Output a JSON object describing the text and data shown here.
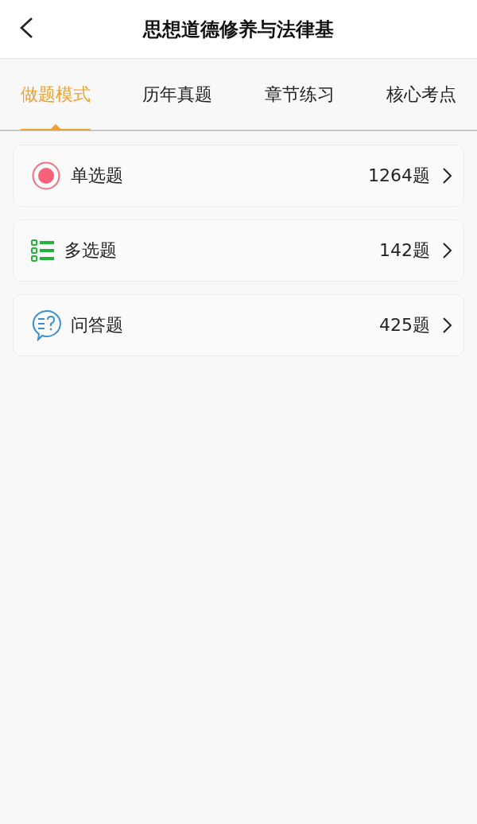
{
  "header": {
    "title": "思想道德修养与法律基"
  },
  "tabs": [
    {
      "label": "做题模式",
      "selected": true
    },
    {
      "label": "历年真题",
      "selected": false
    },
    {
      "label": "章节练习",
      "selected": false
    },
    {
      "label": "核心考点",
      "selected": false
    }
  ],
  "question_types": [
    {
      "kind": "single",
      "label": "单选题",
      "count": "1264题"
    },
    {
      "kind": "multiple",
      "label": "多选题",
      "count": "142题"
    },
    {
      "kind": "qa",
      "label": "问答题",
      "count": "425题"
    }
  ]
}
